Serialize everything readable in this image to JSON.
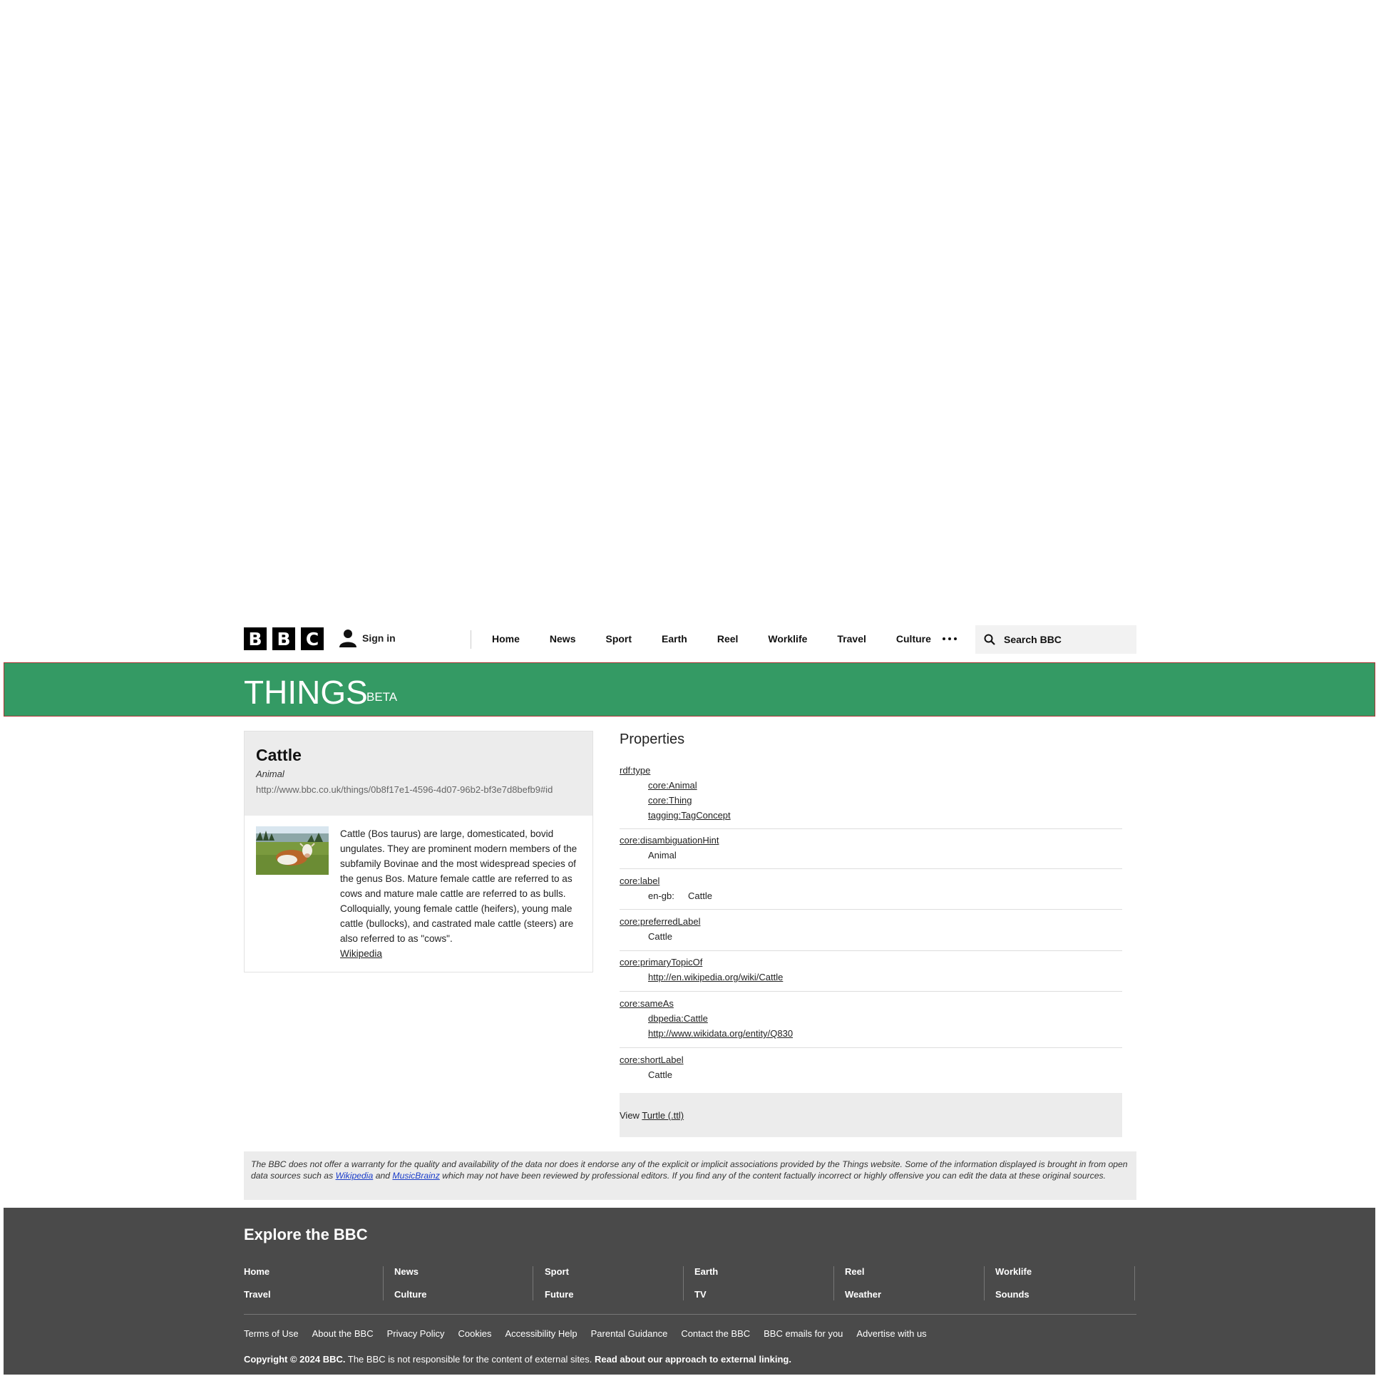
{
  "header": {
    "logo_letters": [
      "B",
      "B",
      "C"
    ],
    "sign_in": "Sign in",
    "nav": [
      "Home",
      "News",
      "Sport",
      "Earth",
      "Reel",
      "Worklife",
      "Travel",
      "Culture"
    ],
    "search_placeholder": "Search BBC"
  },
  "banner": {
    "title": "THINGS",
    "badge": "BETA",
    "color": "#349a64"
  },
  "thing": {
    "name": "Cattle",
    "type": "Animal",
    "uri": "http://www.bbc.co.uk/things/0b8f17e1-4596-4d07-96b2-bf3e7d8befb9#id",
    "description": "Cattle (Bos taurus) are large, domesticated, bovid ungulates. They are prominent modern members of the subfamily Bovinae and the most widespread species of the genus Bos. Mature female cattle are referred to as cows and mature male cattle are referred to as bulls. Colloquially, young female cattle (heifers), young male cattle (bullocks), and castrated male cattle (steers) are also referred to as \"cows\".",
    "source_link": "Wikipedia"
  },
  "properties": {
    "title": "Properties",
    "rdf_type": {
      "key": "rdf:type",
      "values": [
        "core:Animal",
        "core:Thing",
        "tagging:TagConcept"
      ]
    },
    "disambiguation": {
      "key": "core:disambiguationHint",
      "value": "Animal"
    },
    "label": {
      "key": "core:label",
      "lang": "en-gb:",
      "value": "Cattle"
    },
    "preferred_label": {
      "key": "core:preferredLabel",
      "value": "Cattle"
    },
    "primary_topic": {
      "key": "core:primaryTopicOf",
      "value": "http://en.wikipedia.org/wiki/Cattle"
    },
    "same_as": {
      "key": "core:sameAs",
      "values": [
        "dbpedia:Cattle",
        "http://www.wikidata.org/entity/Q830"
      ]
    },
    "short_label": {
      "key": "core:shortLabel",
      "value": "Cattle"
    },
    "view_prefix": "View",
    "view_link": "Turtle (.ttl)"
  },
  "disclaimer": {
    "part1": "The BBC does not offer a warranty for the quality and availability of the data nor does it endorse any of the explicit or implicit associations provided by the Things website. Some of the information displayed is brought in from open data sources such as",
    "link1": "Wikipedia",
    "and": "and",
    "link2": "MusicBrainz",
    "part2": "which may not have been reviewed by professional editors. If you find any of the content factually incorrect or highly offensive you can edit the data at these original sources."
  },
  "footer": {
    "explore": "Explore the BBC",
    "columns": [
      [
        "Home",
        "Travel"
      ],
      [
        "News",
        "Culture"
      ],
      [
        "Sport",
        "Future"
      ],
      [
        "Earth",
        "TV"
      ],
      [
        "Reel",
        "Weather"
      ],
      [
        "Worklife",
        "Sounds"
      ]
    ],
    "links": [
      "Terms of Use",
      "About the BBC",
      "Privacy Policy",
      "Cookies",
      "Accessibility Help",
      "Parental Guidance",
      "Contact the BBC",
      "BBC emails for you",
      "Advertise with us"
    ],
    "copyright": "Copyright © 2024 BBC.",
    "copyright_note": "The BBC is not responsible for the content of external sites.",
    "external_link": "Read about our approach to external linking."
  }
}
